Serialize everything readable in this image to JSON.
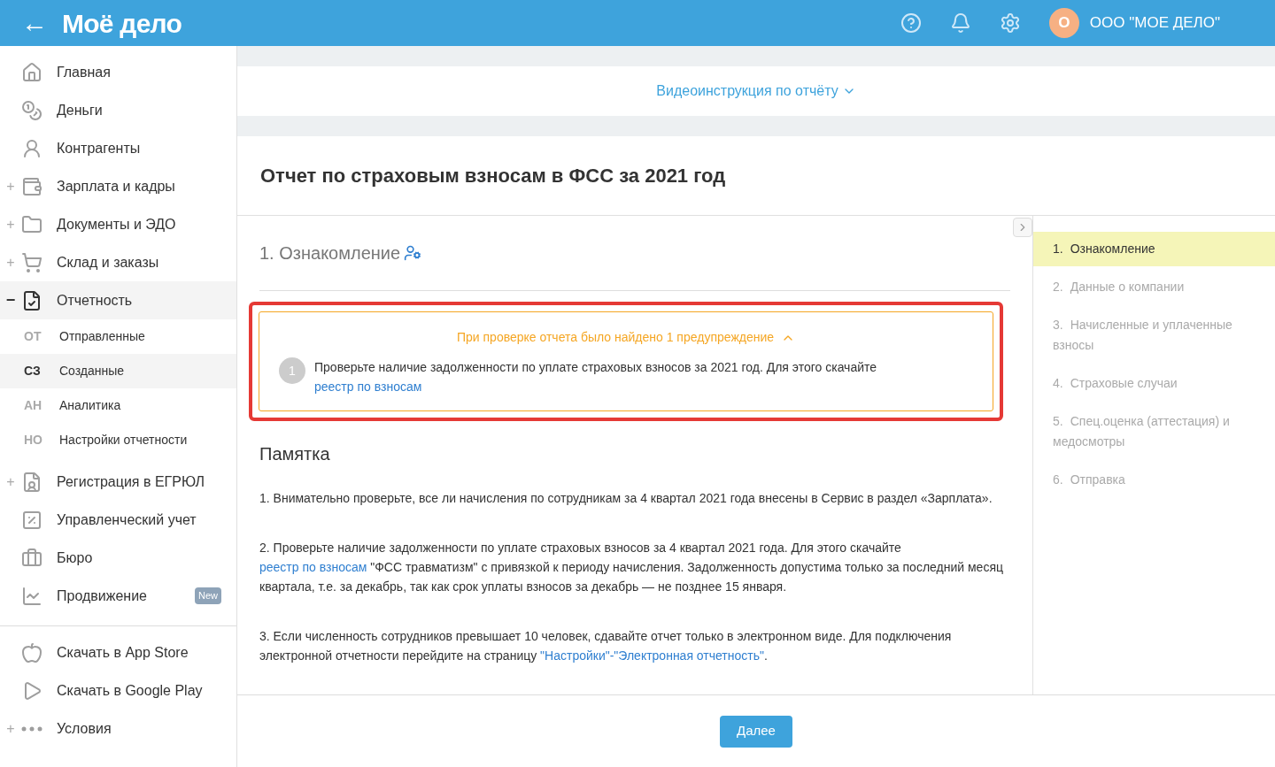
{
  "header": {
    "back": "←",
    "logo": "Моё дело",
    "company_initial": "О",
    "company": "ООО \"МОЕ ДЕЛО\""
  },
  "sidebar": {
    "items": [
      {
        "kind": "home",
        "label": "Главная",
        "selected": false
      },
      {
        "kind": "money",
        "label": "Деньги",
        "selected": false
      },
      {
        "kind": "person",
        "label": "Контрагенты",
        "selected": false
      },
      {
        "kind": "wallet",
        "label": "Зарплата и кадры",
        "toggle": "+",
        "selected": false
      },
      {
        "kind": "folder",
        "label": "Документы и ЭДО",
        "toggle": "+",
        "selected": false
      },
      {
        "kind": "cart",
        "label": "Склад и заказы",
        "toggle": "+",
        "selected": false
      },
      {
        "kind": "report",
        "label": "Отчетность",
        "toggle": "−",
        "selected": true,
        "children": [
          {
            "abbr": "ОТ",
            "label": "Отправленные",
            "selected": false
          },
          {
            "abbr": "СЗ",
            "label": "Созданные",
            "selected": true
          },
          {
            "abbr": "АН",
            "label": "Аналитика",
            "selected": false
          },
          {
            "abbr": "НО",
            "label": "Настройки отчетности",
            "selected": false
          }
        ]
      },
      {
        "kind": "registration",
        "label": "Регистрация в ЕГРЮЛ",
        "toggle": "+",
        "selected": false
      },
      {
        "kind": "ruble",
        "label": "Управленческий учет",
        "selected": false
      },
      {
        "kind": "briefcase",
        "label": "Бюро",
        "selected": false
      },
      {
        "kind": "chart",
        "label": "Продвижение",
        "badge": "New",
        "selected": false
      }
    ],
    "footer_items": [
      {
        "kind": "apple",
        "label": "Скачать в App Store"
      },
      {
        "kind": "play",
        "label": "Скачать в Google Play"
      },
      {
        "kind": "more",
        "label": "Условия",
        "toggle": "+"
      }
    ]
  },
  "video_link": "Видеоинструкция по отчёту",
  "title": "Отчет по страховым взносам в ФСС за 2021 год",
  "section_title": "1. Ознакомление",
  "warning": {
    "highlighted": true,
    "expanded": true,
    "heading": "При проверке отчета было найдено 1 предупреждение",
    "items": [
      {
        "number": "1",
        "parts": [
          {
            "text": "Проверьте наличие задолженности по уплате страховых взносов за 2021 год. Для этого скачайте "
          },
          {
            "text": "реестр по взносам",
            "link": true
          }
        ]
      }
    ]
  },
  "memo": {
    "title": "Памятка",
    "paragraphs": [
      [
        {
          "text": "1. Внимательно проверьте, все ли начисления по сотрудникам за 4 квартал 2021 года внесены в Сервис в раздел «Зарплата»."
        }
      ],
      [
        {
          "text": "2. Проверьте наличие задолженности по уплате страховых взносов за 4 квартал 2021 года. Для этого скачайте "
        },
        {
          "text": "реестр по взносам",
          "link": true
        },
        {
          "text": " \"ФСС травматизм\" с привязкой к периоду начисления. Задолженность допустима только за последний месяц квартала, т.е. за декабрь, так как срок уплаты взносов за декабрь — не позднее 15 января."
        }
      ],
      [
        {
          "text": "3. Если численность сотрудников превышает 10 человек, сдавайте отчет только в электронном виде. Для подключения электронной отчетности перейдите на страницу "
        },
        {
          "text": "\"Настройки\"-\"Электронная отчетность\"",
          "link": true
        },
        {
          "text": "."
        }
      ]
    ]
  },
  "steps": [
    {
      "number": "1.",
      "label": "Ознакомление",
      "selected": true
    },
    {
      "number": "2.",
      "label": "Данные о компании",
      "selected": false
    },
    {
      "number": "3.",
      "label": "Начисленные и уплаченные взносы",
      "selected": false
    },
    {
      "number": "4.",
      "label": "Страховые случаи",
      "selected": false
    },
    {
      "number": "5.",
      "label": "Спец.оценка (аттестация) и медосмотры",
      "selected": false
    },
    {
      "number": "6.",
      "label": "Отправка",
      "selected": false
    }
  ],
  "next_button": "Далее"
}
